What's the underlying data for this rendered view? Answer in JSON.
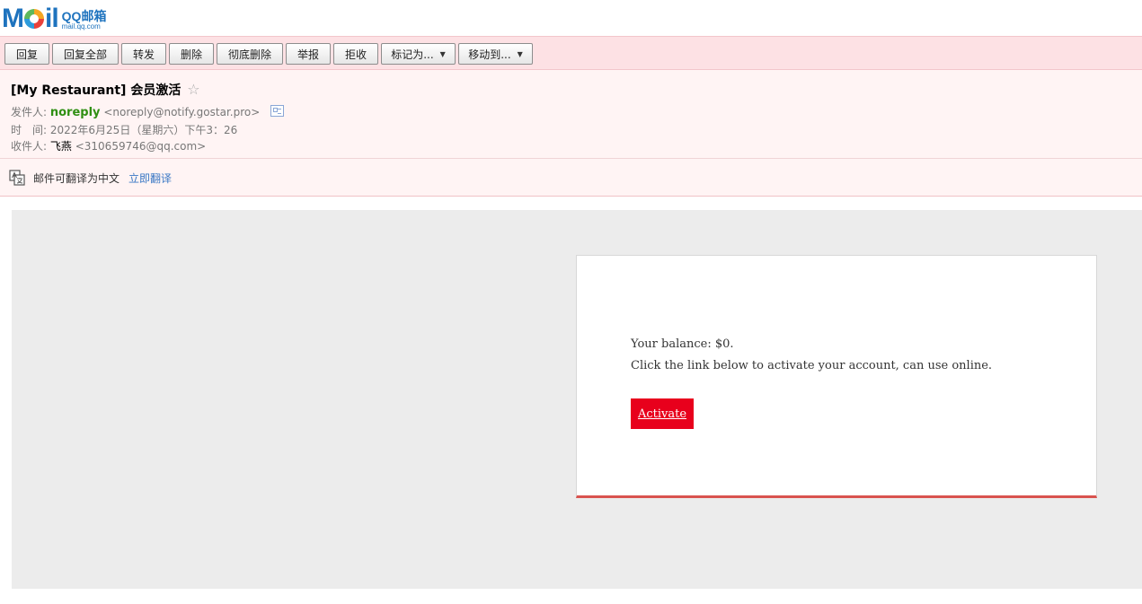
{
  "logo": {
    "wordmark": [
      "M",
      "il"
    ],
    "product": "QQ邮箱",
    "domain": "mail.qq.com"
  },
  "toolbar": {
    "buttons": [
      {
        "label": "回复"
      },
      {
        "label": "回复全部"
      },
      {
        "label": "转发"
      },
      {
        "label": "删除"
      },
      {
        "label": "彻底删除"
      },
      {
        "label": "举报"
      },
      {
        "label": "拒收"
      },
      {
        "label": "标记为...",
        "dropdown": true
      },
      {
        "label": "移动到...",
        "dropdown": true
      }
    ]
  },
  "header": {
    "subject": "[My Restaurant] 会员激活",
    "star": "☆",
    "from_label": "发件人:",
    "from_name": "noreply",
    "from_addr": "<noreply@notify.gostar.pro>",
    "time_label": "时　间:",
    "time_value": "2022年6月25日（星期六）下午3：26",
    "to_label": "收件人:",
    "to_name": "飞燕",
    "to_addr": "<310659746@qq.com>"
  },
  "translate": {
    "text": "邮件可翻译为中文",
    "link": "立即翻译"
  },
  "email_body": {
    "balance": "Your balance: $0.",
    "instruction": "Click the link below to activate your account, can use online.",
    "activate_label": "Activate",
    "accent_color": "#e8001c",
    "card_border_color": "#d9534f"
  }
}
